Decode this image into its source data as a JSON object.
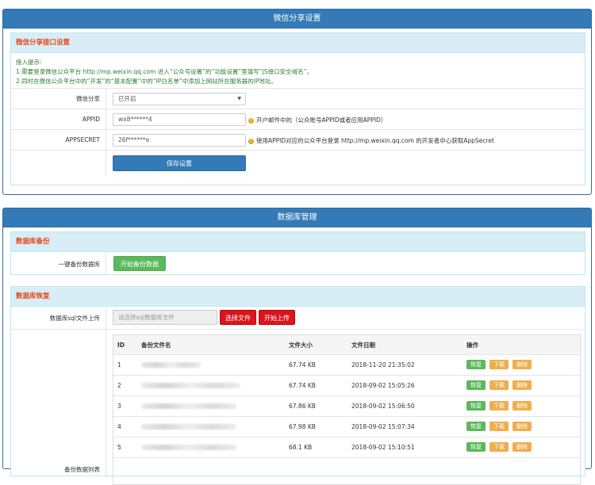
{
  "wechat_panel": {
    "title": "微信分享设置",
    "section_title": "微信分享接口设置",
    "tips": [
      "接入提示:",
      "1.需要登录微信公众平台 http://mp.weixin.qq.com 进入“公众号设置”的“功能设置”里填写“JS接口安全域名”。",
      "2.同时在微信公众平台中的“开发”的“基本配置”中的“IP白名单”中添加上网站所在服务器的IP地址。"
    ],
    "share_label": "微信分享",
    "share_value": "已开启",
    "appid_label": "APPID",
    "appid_value": "wx8******4",
    "appid_hint": "开户邮件中的（公众账号APPID或者应用APPID）",
    "secret_label": "APPSECRET",
    "secret_value": "26f******e",
    "secret_hint": "使用APPID对应的公众平台登录 http://mp.weixin.qq.com 的开发者中心获取AppSecret",
    "save_label": "保存设置"
  },
  "db_panel": {
    "title": "数据库管理",
    "backup_title": "数据库备份",
    "backup_label": "一键备份数据库",
    "backup_button": "开始备份数据",
    "restore_title": "数据库恢复",
    "upload_label": "数据库sql文件上传",
    "upload_placeholder": "请选择sql数据库文件",
    "choose_button": "选择文件",
    "upload_button": "开始上传",
    "backup_list_label": "备份数据列表",
    "table": {
      "headers": [
        "ID",
        "备份文件名",
        "文件大小",
        "文件日期",
        "操作"
      ],
      "rows": [
        {
          "id": "1",
          "size": "67.74 KB",
          "date": "2018-11-20 21:35:02"
        },
        {
          "id": "2",
          "size": "67.74 KB",
          "date": "2018-09-02 15:05:26"
        },
        {
          "id": "3",
          "size": "67.86 KB",
          "date": "2018-09-02 15:06:50"
        },
        {
          "id": "4",
          "size": "67.98 KB",
          "date": "2018-09-02 15:07:34"
        },
        {
          "id": "5",
          "size": "68.1 KB",
          "date": "2018-09-02 15:10:51"
        }
      ],
      "actions": [
        "恢复",
        "下载",
        "删除"
      ]
    }
  },
  "colors": {
    "primary": "#337ab7",
    "success": "#5cb85c",
    "danger": "#d9151e",
    "warning": "#f0ad4e"
  }
}
